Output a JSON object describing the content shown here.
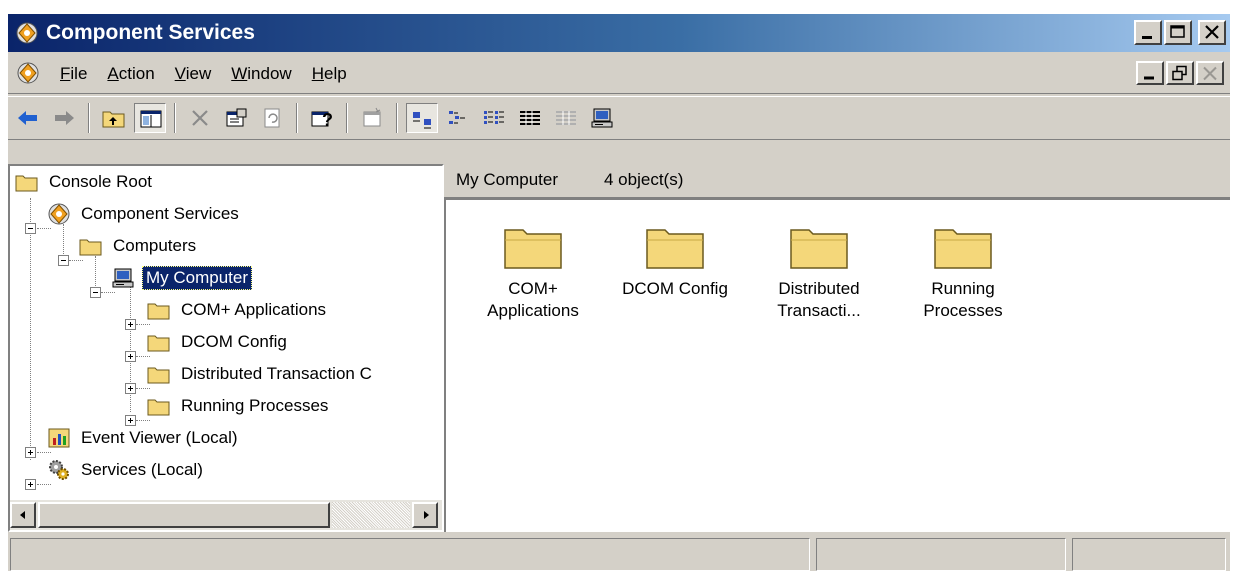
{
  "window": {
    "title": "Component Services"
  },
  "menu": {
    "items": [
      {
        "label": "File",
        "accel": "F",
        "rest": "ile"
      },
      {
        "label": "Action",
        "accel": "A",
        "rest": "ction"
      },
      {
        "label": "View",
        "accel": "V",
        "rest": "iew"
      },
      {
        "label": "Window",
        "accel": "W",
        "rest": "indow"
      },
      {
        "label": "Help",
        "accel": "H",
        "rest": "elp"
      }
    ]
  },
  "toolbar": {
    "buttons": [
      "back-icon",
      "forward-icon",
      "up-one-level-icon",
      "show-hide-console-tree-icon",
      "delete-icon",
      "properties-icon",
      "refresh-icon",
      "help-icon",
      "new-window-icon",
      "large-icons-icon",
      "small-icons-icon",
      "list-icon",
      "detail-icon",
      "configure-icon",
      "computer-icon"
    ]
  },
  "tree": {
    "root": "Console Root",
    "component_services": "Component Services",
    "computers": "Computers",
    "my_computer": "My Computer",
    "com_apps": "COM+ Applications",
    "dcom": "DCOM Config",
    "dtc": "Distributed Transaction C",
    "running": "Running Processes",
    "event_viewer": "Event Viewer (Local)",
    "services": "Services (Local)"
  },
  "details": {
    "location": "My Computer",
    "count": "4 object(s)",
    "items": [
      {
        "line1": "COM+",
        "line2": "Applications"
      },
      {
        "line1": "DCOM Config",
        "line2": ""
      },
      {
        "line1": "Distributed",
        "line2": "Transacti..."
      },
      {
        "line1": "Running",
        "line2": "Processes"
      }
    ]
  },
  "colors": {
    "title_start": "#0a246a",
    "title_end": "#a6caf0",
    "face": "#d4d0c8",
    "folder": "#f4d77a",
    "selection": "#0a246a"
  }
}
